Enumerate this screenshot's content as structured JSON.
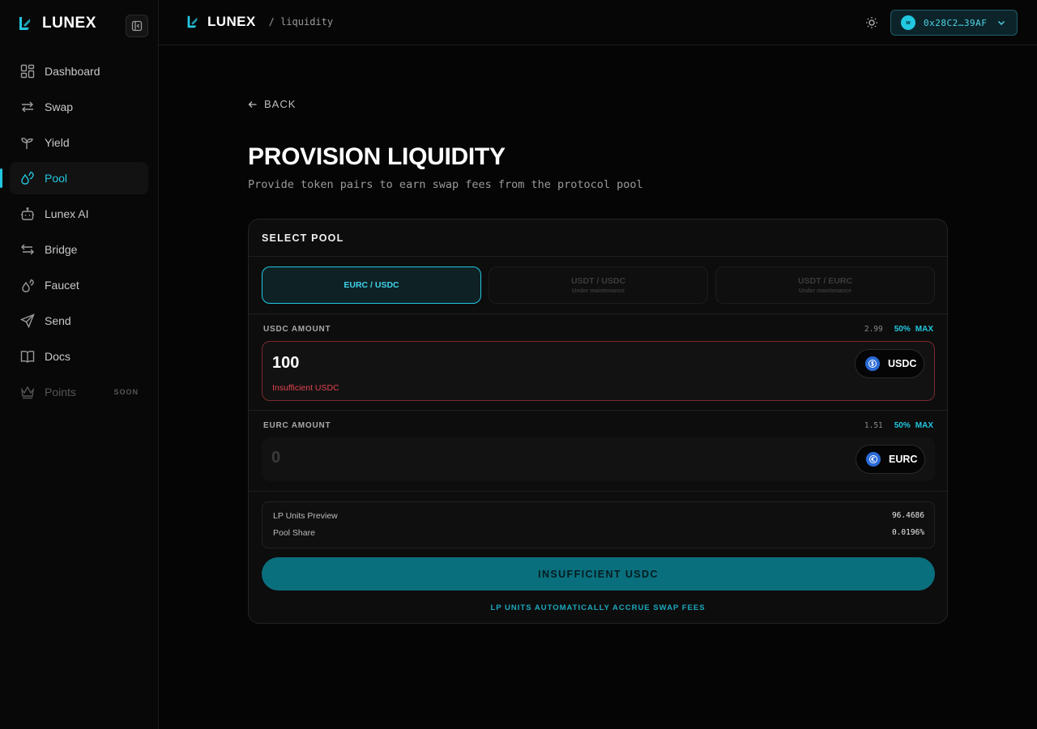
{
  "app": {
    "name": "LUNEX"
  },
  "topbar": {
    "brand": "LUNEX",
    "crumb": "/ liquidity",
    "wallet": "0x28C2…39AF",
    "wallet_badge": "w"
  },
  "sidebar": {
    "items": [
      {
        "label": "Dashboard",
        "icon": "dashboard-icon"
      },
      {
        "label": "Swap",
        "icon": "swap-icon"
      },
      {
        "label": "Yield",
        "icon": "sprout-icon"
      },
      {
        "label": "Pool",
        "icon": "droplet-icon",
        "active": true
      },
      {
        "label": "Lunex AI",
        "icon": "bot-icon"
      },
      {
        "label": "Bridge",
        "icon": "bridge-icon"
      },
      {
        "label": "Faucet",
        "icon": "faucet-icon"
      },
      {
        "label": "Send",
        "icon": "send-icon"
      },
      {
        "label": "Docs",
        "icon": "book-icon"
      },
      {
        "label": "Points",
        "icon": "crown-icon",
        "badge": "SOON",
        "disabled": true
      }
    ]
  },
  "page": {
    "back": "BACK",
    "title": "PROVISION LIQUIDITY",
    "subtitle": "Provide token pairs to earn swap fees from the protocol pool"
  },
  "card": {
    "title": "SELECT POOL",
    "pools": [
      {
        "label": "EURC / USDC",
        "status": ""
      },
      {
        "label": "USDT / USDC",
        "status": "Under maintenance"
      },
      {
        "label": "USDT / EURC",
        "status": "Under maintenance"
      }
    ],
    "usdc": {
      "label": "USDC AMOUNT",
      "balance": "2.99",
      "pct": "50%",
      "max": "MAX",
      "value": "100",
      "token": "USDC",
      "error": "Insufficient USDC"
    },
    "eurc": {
      "label": "EURC AMOUNT",
      "balance": "1.51",
      "pct": "50%",
      "max": "MAX",
      "value": "0",
      "token": "EURC"
    },
    "preview": {
      "lp_label": "LP Units Preview",
      "lp_value": "96.4686",
      "share_label": "Pool Share",
      "share_value": "0.0196%"
    },
    "cta": "INSUFFICIENT USDC",
    "note": "LP UNITS AUTOMATICALLY ACCRUE SWAP FEES"
  },
  "colors": {
    "accent": "#22c7e0",
    "error": "#e0444f",
    "cta": "#0a6f7d"
  }
}
